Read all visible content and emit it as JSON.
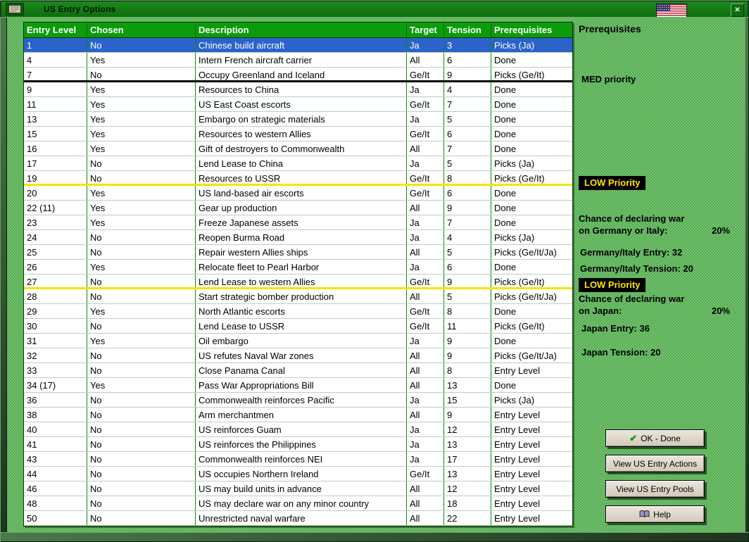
{
  "window": {
    "title": "US Entry Options"
  },
  "icons": {
    "close": "✕",
    "check": "✔"
  },
  "table": {
    "columns": [
      "Entry Level",
      "Chosen",
      "Description",
      "Target",
      "Tension",
      "Prerequisites"
    ],
    "rows": [
      {
        "entry_level": "1",
        "chosen": "No",
        "description": "Chinese build aircraft",
        "target": "Ja",
        "tension": "3",
        "prerequisites": "Picks (Ja)",
        "selected": true
      },
      {
        "entry_level": "4",
        "chosen": "Yes",
        "description": "Intern French aircraft carrier",
        "target": "All",
        "tension": "6",
        "prerequisites": "Done"
      },
      {
        "entry_level": "7",
        "chosen": "No",
        "description": "Occupy Greenland and Iceland",
        "target": "Ge/It",
        "tension": "9",
        "prerequisites": "Picks (Ge/It)",
        "separator": "black"
      },
      {
        "entry_level": "9",
        "chosen": "Yes",
        "description": "Resources to China",
        "target": "Ja",
        "tension": "4",
        "prerequisites": "Done"
      },
      {
        "entry_level": "11",
        "chosen": "Yes",
        "description": "US East Coast escorts",
        "target": "Ge/It",
        "tension": "7",
        "prerequisites": "Done"
      },
      {
        "entry_level": "13",
        "chosen": "Yes",
        "description": "Embargo on strategic materials",
        "target": "Ja",
        "tension": "5",
        "prerequisites": "Done"
      },
      {
        "entry_level": "15",
        "chosen": "Yes",
        "description": "Resources to western Allies",
        "target": "Ge/It",
        "tension": "6",
        "prerequisites": "Done"
      },
      {
        "entry_level": "16",
        "chosen": "Yes",
        "description": "Gift of destroyers to Commonwealth",
        "target": "All",
        "tension": "7",
        "prerequisites": "Done"
      },
      {
        "entry_level": "17",
        "chosen": "No",
        "description": "Lend Lease to China",
        "target": "Ja",
        "tension": "5",
        "prerequisites": "Picks (Ja)"
      },
      {
        "entry_level": "19",
        "chosen": "No",
        "description": "Resources to USSR",
        "target": "Ge/It",
        "tension": "8",
        "prerequisites": "Picks (Ge/It)",
        "separator": "yellow"
      },
      {
        "entry_level": "20",
        "chosen": "Yes",
        "description": "US land-based air escorts",
        "target": "Ge/It",
        "tension": "6",
        "prerequisites": "Done"
      },
      {
        "entry_level": "22 (11)",
        "chosen": "Yes",
        "description": "Gear up production",
        "target": "All",
        "tension": "9",
        "prerequisites": "Done"
      },
      {
        "entry_level": "23",
        "chosen": "Yes",
        "description": "Freeze Japanese assets",
        "target": "Ja",
        "tension": "7",
        "prerequisites": "Done"
      },
      {
        "entry_level": "24",
        "chosen": "No",
        "description": "Reopen Burma Road",
        "target": "Ja",
        "tension": "4",
        "prerequisites": "Picks (Ja)"
      },
      {
        "entry_level": "25",
        "chosen": "No",
        "description": "Repair western Allies ships",
        "target": "All",
        "tension": "5",
        "prerequisites": "Picks (Ge/It/Ja)"
      },
      {
        "entry_level": "26",
        "chosen": "Yes",
        "description": "Relocate fleet to Pearl Harbor",
        "target": "Ja",
        "tension": "6",
        "prerequisites": "Done"
      },
      {
        "entry_level": "27",
        "chosen": "No",
        "description": "Lend Lease to western Allies",
        "target": "Ge/It",
        "tension": "9",
        "prerequisites": "Picks (Ge/It)",
        "separator": "yellow"
      },
      {
        "entry_level": "28",
        "chosen": "No",
        "description": "Start strategic bomber production",
        "target": "All",
        "tension": "5",
        "prerequisites": "Picks (Ge/It/Ja)"
      },
      {
        "entry_level": "29",
        "chosen": "Yes",
        "description": "North Atlantic escorts",
        "target": "Ge/It",
        "tension": "8",
        "prerequisites": "Done"
      },
      {
        "entry_level": "30",
        "chosen": "No",
        "description": "Lend Lease to USSR",
        "target": "Ge/It",
        "tension": "11",
        "prerequisites": "Picks (Ge/It)"
      },
      {
        "entry_level": "31",
        "chosen": "Yes",
        "description": "Oil embargo",
        "target": "Ja",
        "tension": "9",
        "prerequisites": "Done"
      },
      {
        "entry_level": "32",
        "chosen": "No",
        "description": "US refutes Naval War zones",
        "target": "All",
        "tension": "9",
        "prerequisites": "Picks (Ge/It/Ja)"
      },
      {
        "entry_level": "33",
        "chosen": "No",
        "description": "Close Panama Canal",
        "target": "All",
        "tension": "8",
        "prerequisites": "Entry Level"
      },
      {
        "entry_level": "34 (17)",
        "chosen": "Yes",
        "description": "Pass War Appropriations Bill",
        "target": "All",
        "tension": "13",
        "prerequisites": "Done"
      },
      {
        "entry_level": "36",
        "chosen": "No",
        "description": "Commonwealth reinforces Pacific",
        "target": "Ja",
        "tension": "15",
        "prerequisites": "Picks (Ja)"
      },
      {
        "entry_level": "38",
        "chosen": "No",
        "description": "Arm merchantmen",
        "target": "All",
        "tension": "9",
        "prerequisites": "Entry Level"
      },
      {
        "entry_level": "40",
        "chosen": "No",
        "description": "US reinforces Guam",
        "target": "Ja",
        "tension": "12",
        "prerequisites": "Entry Level"
      },
      {
        "entry_level": "41",
        "chosen": "No",
        "description": "US reinforces the Philippines",
        "target": "Ja",
        "tension": "13",
        "prerequisites": "Entry Level"
      },
      {
        "entry_level": "43",
        "chosen": "No",
        "description": "Commonwealth reinforces NEI",
        "target": "Ja",
        "tension": "17",
        "prerequisites": "Entry Level"
      },
      {
        "entry_level": "44",
        "chosen": "No",
        "description": "US occupies Northern Ireland",
        "target": "Ge/It",
        "tension": "13",
        "prerequisites": "Entry Level"
      },
      {
        "entry_level": "46",
        "chosen": "No",
        "description": "US may build units in advance",
        "target": "All",
        "tension": "12",
        "prerequisites": "Entry Level"
      },
      {
        "entry_level": "48",
        "chosen": "No",
        "description": "US may declare war on any minor country",
        "target": "All",
        "tension": "18",
        "prerequisites": "Entry Level"
      },
      {
        "entry_level": "50",
        "chosen": "No",
        "description": "Unrestricted naval warfare",
        "target": "All",
        "tension": "22",
        "prerequisites": "Entry Level"
      }
    ]
  },
  "sidebar": {
    "prerequisites_heading": "Prerequisites",
    "med_priority": "MED priority",
    "low_priority_label": "LOW Priority",
    "germany": {
      "line1": "Chance of declaring war",
      "line2": "on Germany or Italy:",
      "value": "20%",
      "entry": "Germany/Italy Entry: 32",
      "tension": "Germany/Italy Tension: 20"
    },
    "japan": {
      "line1": "Chance of declaring war",
      "line2": "on Japan:",
      "value": "20%",
      "entry": "Japan Entry: 36",
      "tension": "Japan Tension: 20"
    },
    "buttons": {
      "ok": "OK - Done",
      "view_actions": "View US Entry Actions",
      "view_pools": "View US Entry Pools",
      "help": "Help"
    }
  }
}
